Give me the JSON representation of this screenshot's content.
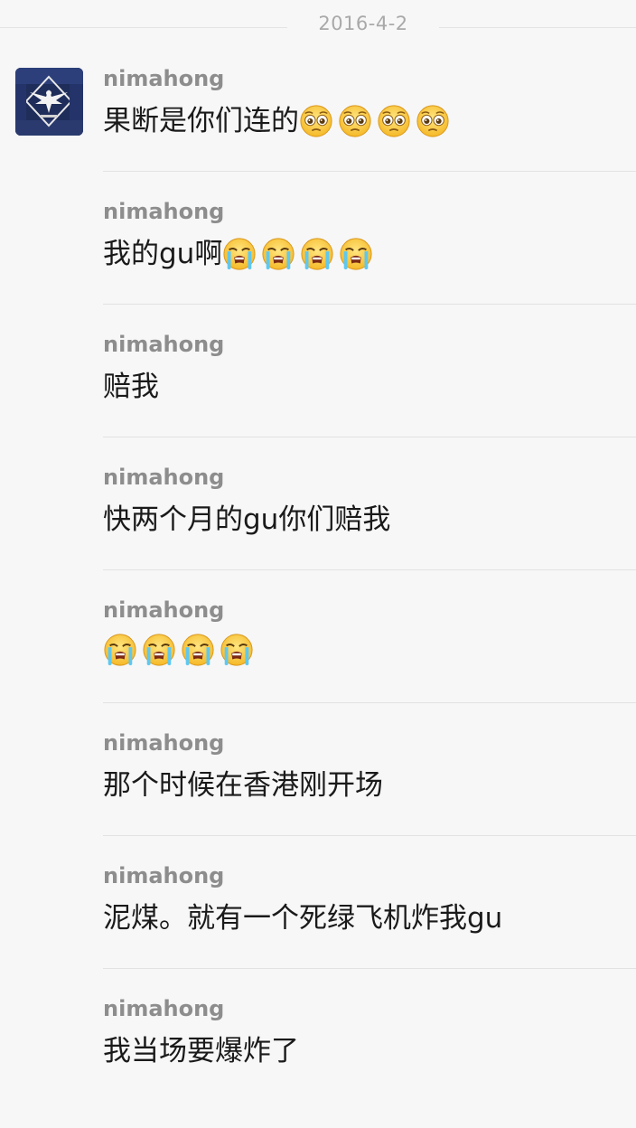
{
  "date_separator": "2016-4-2",
  "messages": [
    {
      "sender": "nimahong",
      "text": "果断是你们连的",
      "emojis": [
        "pleading-face-icon",
        "pleading-face-icon",
        "pleading-face-icon",
        "pleading-face-icon"
      ]
    },
    {
      "sender": "nimahong",
      "text": "我的gu啊",
      "emojis": [
        "loudly-crying-face-icon",
        "loudly-crying-face-icon",
        "loudly-crying-face-icon",
        "loudly-crying-face-icon"
      ]
    },
    {
      "sender": "nimahong",
      "text": "赔我",
      "emojis": []
    },
    {
      "sender": "nimahong",
      "text": "快两个月的gu你们赔我",
      "emojis": []
    },
    {
      "sender": "nimahong",
      "text": "",
      "emojis": [
        "loudly-crying-face-icon",
        "loudly-crying-face-icon",
        "loudly-crying-face-icon",
        "loudly-crying-face-icon"
      ]
    },
    {
      "sender": "nimahong",
      "text": "那个时候在香港刚开场",
      "emojis": []
    },
    {
      "sender": "nimahong",
      "text": "泥煤。就有一个死绿飞机炸我gu",
      "emojis": []
    },
    {
      "sender": "nimahong",
      "text": "我当场要爆炸了",
      "emojis": []
    }
  ]
}
